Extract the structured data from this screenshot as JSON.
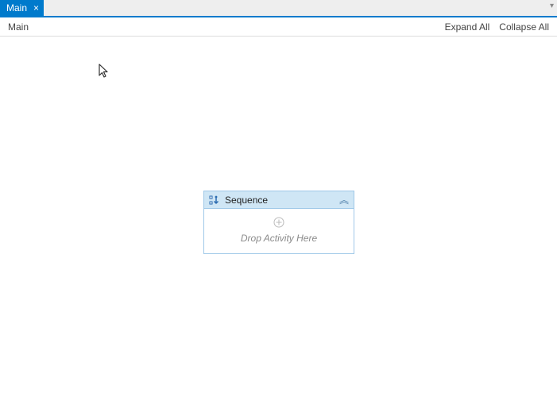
{
  "tabbar": {
    "tab_label": "Main",
    "close_glyph": "×",
    "menu_glyph": "▾"
  },
  "toolbar": {
    "breadcrumb": "Main",
    "expand_label": "Expand All",
    "collapse_label": "Collapse All"
  },
  "activity": {
    "title": "Sequence",
    "drop_hint": "Drop Activity Here",
    "collapse_glyph": "︽"
  }
}
